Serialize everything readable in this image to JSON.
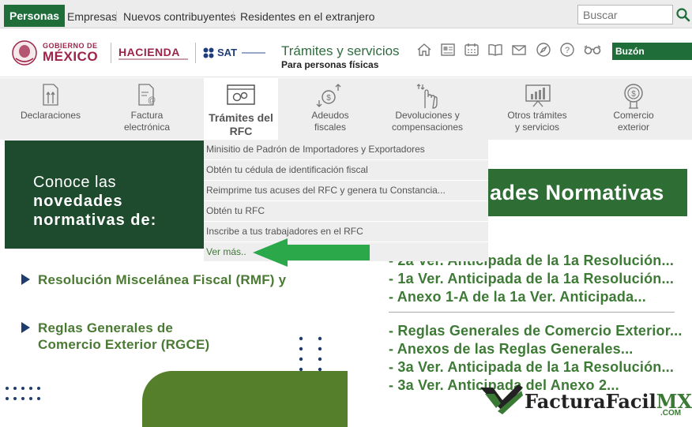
{
  "topbar": {
    "tabs": [
      "Personas",
      "Empresas",
      "Nuevos contribuyentes",
      "Residentes en el extranjero"
    ],
    "search_placeholder": "Buscar"
  },
  "header": {
    "gobierno": "GOBIERNO DE",
    "mexico": "MÉXICO",
    "hacienda": "HACIENDA",
    "sat": "SAT",
    "title": "Trámites y servicios",
    "subtitle": "Para personas físicas",
    "icons": [
      "home-icon",
      "news-icon",
      "calendar-icon",
      "book-icon",
      "mail-icon",
      "compass-icon",
      "help-icon",
      "glasses-icon"
    ],
    "buzon": "Buzón Tributario"
  },
  "nav": {
    "declaraciones": "Declaraciones",
    "factura_1": "Factura",
    "factura_2": "electrónica",
    "rfc_1": "Trámites del",
    "rfc_2": "RFC",
    "adeudos_1": "Adeudos",
    "adeudos_2": "fiscales",
    "devol_1": "Devoluciones y",
    "devol_2": "compensaciones",
    "otros_1": "Otros trámites",
    "otros_2": "y servicios",
    "comercio_1": "Comercio",
    "comercio_2": "exterior"
  },
  "dropdown": [
    "Minisitio de Padrón de Importadores y Exportadores",
    "Obtén tu cédula de identificación fiscal",
    "Reimprime tus acuses del RFC y genera tu Constancia...",
    "Obtén tu RFC",
    "Inscribe a tus trabajadores en el RFC",
    "Ver más.."
  ],
  "banner": {
    "line1": "Conoce las",
    "line2": "novedades",
    "line3": "normativas de:",
    "item1": "Resolución Miscelánea Fiscal (RMF) y",
    "item2_1": "Reglas Generales de",
    "item2_2": "Comercio Exterior (RGCE)"
  },
  "right": {
    "title": "ades Normativas",
    "list1": [
      "- 2a Ver. Anticipada de la 1a Resolución...",
      "- 1a Ver. Anticipada de la 1a Resolución...",
      "- Anexo 1-A de la 1a Ver. Anticipada..."
    ],
    "list2": [
      "- Reglas Generales de Comercio Exterior...",
      "- Anexos de las Reglas Generales...",
      "- 3a Ver. Anticipada de la 1a Resolución...",
      "- 3a Ver. Anticipada del Anexo 2..."
    ]
  },
  "watermark": {
    "name": "FacturaFacil",
    "mx": "MX",
    "com": ".COM"
  },
  "colors": {
    "green_primary": "#1f6e3a",
    "green_banner": "#1e4b2d",
    "green_text": "#3d7a35",
    "guinda": "#9d2449",
    "navy": "#1e3d6e",
    "arrow": "#2aa84a"
  }
}
